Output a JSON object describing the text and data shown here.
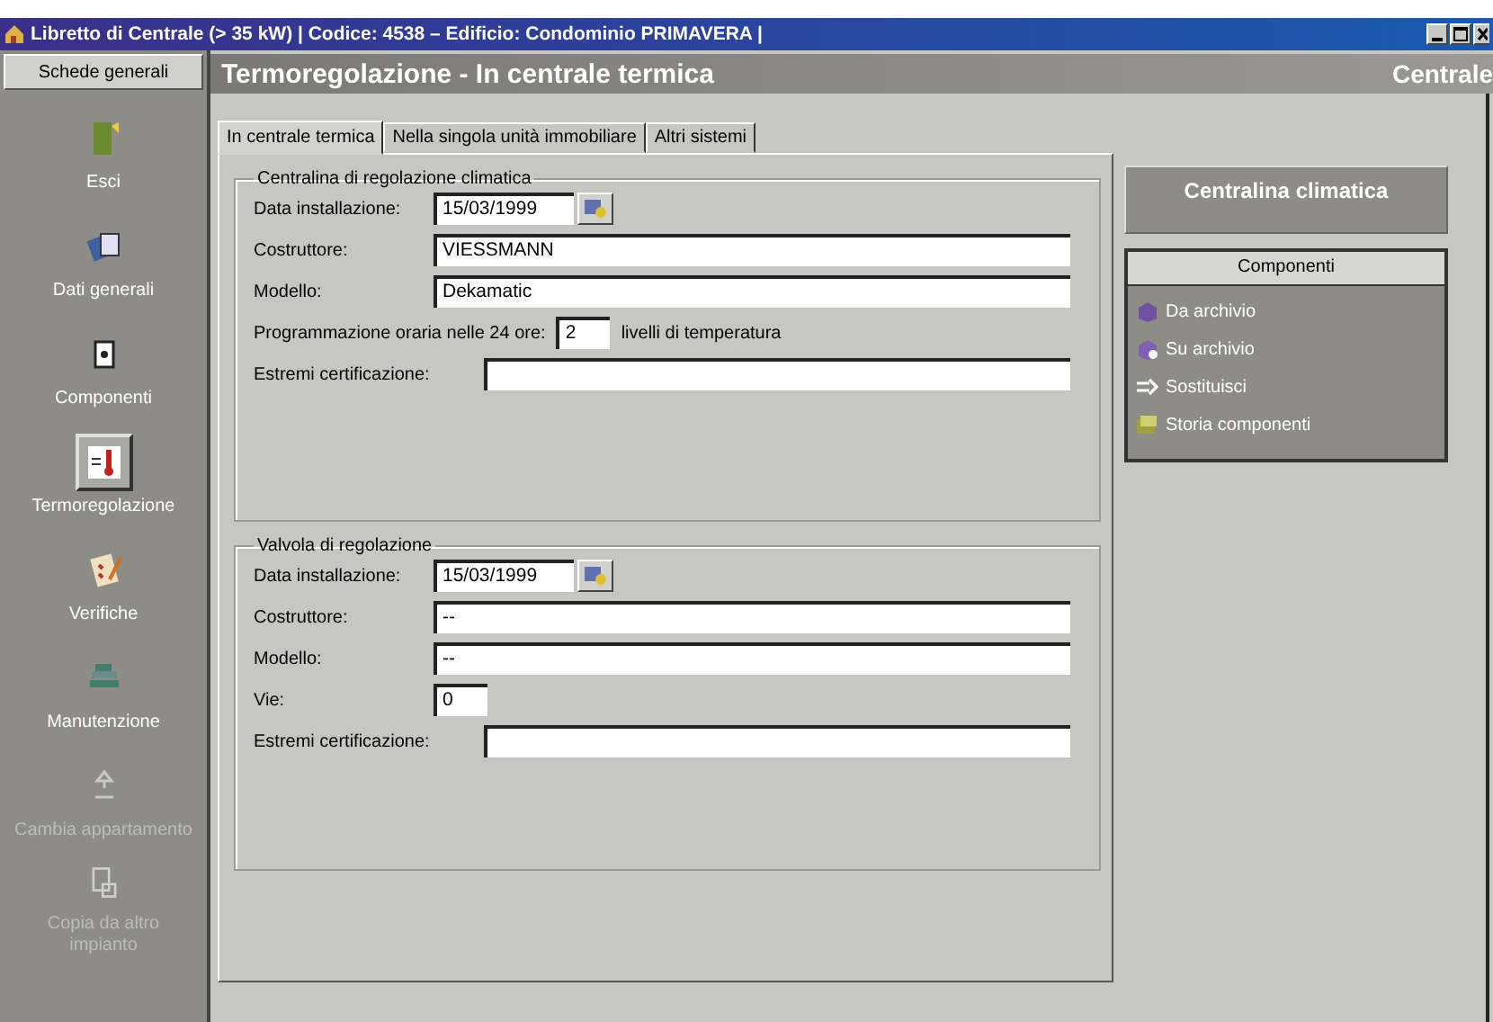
{
  "window": {
    "title": "Libretto di Centrale (> 35 kW) | Codice: 4538 – Edificio: Condominio PRIMAVERA |"
  },
  "sidebar": {
    "header": "Schede generali",
    "items": [
      {
        "label": "Esci",
        "selected": false,
        "disabled": false
      },
      {
        "label": "Dati generali",
        "selected": false,
        "disabled": false
      },
      {
        "label": "Componenti",
        "selected": false,
        "disabled": false
      },
      {
        "label": "Termoregolazione",
        "selected": true,
        "disabled": false
      },
      {
        "label": "Verifiche",
        "selected": false,
        "disabled": false
      },
      {
        "label": "Manutenzione",
        "selected": false,
        "disabled": false
      },
      {
        "label": "Cambia appartamento",
        "selected": false,
        "disabled": true
      },
      {
        "label": "Copia da altro impianto",
        "selected": false,
        "disabled": true
      }
    ]
  },
  "header": {
    "title": "Termoregolazione - In centrale termica",
    "right": "Centrale"
  },
  "tabs": [
    {
      "label": "In centrale termica",
      "selected": true
    },
    {
      "label": "Nella singola unità immobiliare",
      "selected": false
    },
    {
      "label": "Altri sistemi",
      "selected": false
    }
  ],
  "groups": [
    {
      "title": "Centralina di regolazione climatica",
      "fields": [
        {
          "kind": "date",
          "label": "Data installazione:",
          "value": "15/03/1999"
        },
        {
          "kind": "text",
          "label": "Costruttore:",
          "value": "VIESSMANN"
        },
        {
          "kind": "text",
          "label": "Modello:",
          "value": "Dekamatic"
        },
        {
          "kind": "short",
          "label": "Programmazione oraria nelle 24 ore:",
          "value": "2",
          "suffix": "livelli di temperatura"
        },
        {
          "kind": "text",
          "label": "Estremi certificazione:"
        }
      ]
    },
    {
      "title": "Valvola di regolazione",
      "fields": [
        {
          "kind": "date",
          "label": "Data installazione:",
          "value": "15/03/1999"
        },
        {
          "kind": "text",
          "label": "Costruttore:",
          "value": "--"
        },
        {
          "kind": "text",
          "label": "Modello:",
          "value": "--"
        },
        {
          "kind": "short",
          "label": "Vie:",
          "value": "0"
        },
        {
          "kind": "text",
          "label": "Estremi certificazione:"
        }
      ]
    }
  ],
  "side_panel": {
    "title": "Centralina climatica",
    "list_header": "Componenti",
    "actions": [
      {
        "label": "Da archivio"
      },
      {
        "label": "Su archivio"
      },
      {
        "label": "Sostituisci"
      },
      {
        "label": "Storia componenti"
      }
    ]
  }
}
